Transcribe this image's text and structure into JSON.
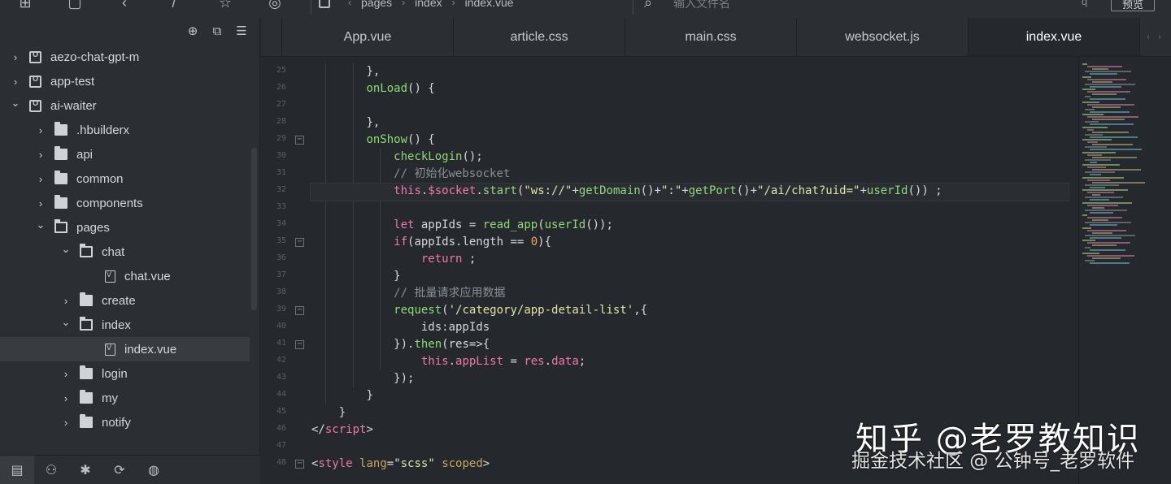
{
  "toolbar": {
    "breadcrumb": [
      "pages",
      "index",
      "index.vue"
    ],
    "search_placeholder": "输入文件名",
    "small_label": "q",
    "preview_label": "预览",
    "icons": [
      "new-file-icon",
      "window-icon",
      "back-icon",
      "forward-icon",
      "star-icon",
      "run-icon",
      "file-search-icon"
    ]
  },
  "sidebar": {
    "actions": [
      "target-icon",
      "collapse-icon",
      "menu-icon"
    ],
    "tree": [
      {
        "label": "aezo-chat-gpt-m",
        "type": "project",
        "level": 0,
        "expanded": false
      },
      {
        "label": "app-test",
        "type": "project",
        "level": 0,
        "expanded": false
      },
      {
        "label": "ai-waiter",
        "type": "project",
        "level": 0,
        "expanded": true
      },
      {
        "label": ".hbuilderx",
        "type": "folder",
        "level": 1,
        "expanded": false
      },
      {
        "label": "api",
        "type": "folder",
        "level": 1,
        "expanded": false
      },
      {
        "label": "common",
        "type": "folder",
        "level": 1,
        "expanded": false
      },
      {
        "label": "components",
        "type": "folder",
        "level": 1,
        "expanded": false
      },
      {
        "label": "pages",
        "type": "folder",
        "level": 1,
        "expanded": true
      },
      {
        "label": "chat",
        "type": "folder",
        "level": 2,
        "expanded": true
      },
      {
        "label": "chat.vue",
        "type": "file",
        "level": 3
      },
      {
        "label": "create",
        "type": "folder",
        "level": 2,
        "expanded": false
      },
      {
        "label": "index",
        "type": "folder",
        "level": 2,
        "expanded": true
      },
      {
        "label": "index.vue",
        "type": "file",
        "level": 3,
        "selected": true
      },
      {
        "label": "login",
        "type": "folder",
        "level": 2,
        "expanded": false
      },
      {
        "label": "my",
        "type": "folder",
        "level": 2,
        "expanded": false
      },
      {
        "label": "notify",
        "type": "folder",
        "level": 2,
        "expanded": false
      }
    ],
    "bottom_icons": [
      "project-manager-icon",
      "plugin-icon",
      "debug-icon",
      "git-icon",
      "browser-icon"
    ]
  },
  "tabs": [
    {
      "label": "App.vue",
      "active": false
    },
    {
      "label": "article.css",
      "active": false
    },
    {
      "label": "main.css",
      "active": false
    },
    {
      "label": "websocket.js",
      "active": false
    },
    {
      "label": "index.vue",
      "active": true
    }
  ],
  "editor": {
    "lines": [
      {
        "n": "25",
        "fold": false,
        "indent": 2,
        "tokens": [
          [
            "p",
            "},"
          ]
        ]
      },
      {
        "n": "26",
        "fold": false,
        "indent": 2,
        "tokens": [
          [
            "f",
            "onLoad"
          ],
          [
            "p",
            "() {"
          ]
        ]
      },
      {
        "n": "27",
        "fold": false,
        "indent": 3,
        "tokens": []
      },
      {
        "n": "28",
        "fold": false,
        "indent": 2,
        "tokens": [
          [
            "p",
            "},"
          ]
        ]
      },
      {
        "n": "29",
        "fold": true,
        "indent": 2,
        "tokens": [
          [
            "f",
            "onShow"
          ],
          [
            "p",
            "() {"
          ]
        ]
      },
      {
        "n": "30",
        "fold": false,
        "indent": 3,
        "tokens": [
          [
            "f",
            "checkLogin"
          ],
          [
            "p",
            "();"
          ]
        ]
      },
      {
        "n": "31",
        "fold": false,
        "indent": 3,
        "tokens": [
          [
            "c",
            "// 初始化websocket"
          ]
        ]
      },
      {
        "n": "32",
        "fold": false,
        "indent": 3,
        "current": true,
        "tokens": [
          [
            "k",
            "this"
          ],
          [
            "p",
            "."
          ],
          [
            "k",
            "$socket"
          ],
          [
            "p",
            "."
          ],
          [
            "f",
            "start"
          ],
          [
            "p",
            "("
          ],
          [
            "s",
            "\"ws://\""
          ],
          [
            "p",
            "+"
          ],
          [
            "f",
            "getDomain"
          ],
          [
            "p",
            "()+"
          ],
          [
            "s",
            "\":\""
          ],
          [
            "p",
            "+"
          ],
          [
            "f",
            "getPort"
          ],
          [
            "p",
            "()+"
          ],
          [
            "s",
            "\"/ai/chat?uid=\""
          ],
          [
            "p",
            "+"
          ],
          [
            "f",
            "userId"
          ],
          [
            "p",
            "()) ;"
          ]
        ]
      },
      {
        "n": "33",
        "fold": false,
        "indent": 3,
        "tokens": []
      },
      {
        "n": "34",
        "fold": false,
        "indent": 3,
        "tokens": [
          [
            "k",
            "let"
          ],
          [
            "p",
            " appIds = "
          ],
          [
            "f",
            "read_app"
          ],
          [
            "p",
            "("
          ],
          [
            "f",
            "userId"
          ],
          [
            "p",
            "());"
          ]
        ]
      },
      {
        "n": "35",
        "fold": true,
        "indent": 3,
        "tokens": [
          [
            "k",
            "if"
          ],
          [
            "p",
            "(appIds.length == "
          ],
          [
            "n",
            "0"
          ],
          [
            "p",
            "){"
          ]
        ]
      },
      {
        "n": "36",
        "fold": false,
        "indent": 4,
        "tokens": [
          [
            "k",
            "return"
          ],
          [
            "p",
            " ;"
          ]
        ]
      },
      {
        "n": "37",
        "fold": false,
        "indent": 3,
        "tokens": [
          [
            "p",
            "}"
          ]
        ]
      },
      {
        "n": "38",
        "fold": false,
        "indent": 3,
        "tokens": [
          [
            "c",
            "// 批量请求应用数据"
          ]
        ]
      },
      {
        "n": "39",
        "fold": true,
        "indent": 3,
        "tokens": [
          [
            "f",
            "request"
          ],
          [
            "p",
            "("
          ],
          [
            "s",
            "'/category/app-detail-list'"
          ],
          [
            "p",
            ",{"
          ]
        ]
      },
      {
        "n": "40",
        "fold": false,
        "indent": 4,
        "tokens": [
          [
            "p",
            "ids:appIds"
          ]
        ]
      },
      {
        "n": "41",
        "fold": true,
        "indent": 3,
        "tokens": [
          [
            "p",
            "})."
          ],
          [
            "f",
            "then"
          ],
          [
            "p",
            "(res=>{"
          ]
        ]
      },
      {
        "n": "42",
        "fold": false,
        "indent": 4,
        "tokens": [
          [
            "k",
            "this"
          ],
          [
            "p",
            "."
          ],
          [
            "k",
            "appList"
          ],
          [
            "p",
            " = "
          ],
          [
            "k",
            "res"
          ],
          [
            "p",
            "."
          ],
          [
            "k",
            "data"
          ],
          [
            "p",
            ";"
          ]
        ]
      },
      {
        "n": "43",
        "fold": false,
        "indent": 3,
        "tokens": [
          [
            "p",
            "});"
          ]
        ]
      },
      {
        "n": "44",
        "fold": false,
        "indent": 2,
        "tokens": [
          [
            "p",
            "}"
          ]
        ]
      },
      {
        "n": "45",
        "fold": false,
        "indent": 1,
        "tokens": [
          [
            "p",
            "}"
          ]
        ]
      },
      {
        "n": "46",
        "fold": false,
        "indent": 0,
        "tokens": [
          [
            "p",
            "</"
          ],
          [
            "t",
            "script"
          ],
          [
            "p",
            ">"
          ]
        ]
      },
      {
        "n": "47",
        "fold": false,
        "indent": 0,
        "tokens": []
      },
      {
        "n": "48",
        "fold": true,
        "indent": 0,
        "tokens": [
          [
            "p",
            "<"
          ],
          [
            "t",
            "style"
          ],
          [
            "p",
            " "
          ],
          [
            "a",
            "lang"
          ],
          [
            "p",
            "="
          ],
          [
            "s",
            "\"scss\""
          ],
          [
            "p",
            " "
          ],
          [
            "a",
            "scoped"
          ],
          [
            "p",
            ">"
          ]
        ]
      }
    ]
  },
  "watermark": {
    "line1": "知乎 @老罗教知识",
    "line2": "掘金技术社区 @ 公钟号_老罗软件"
  },
  "colors": {
    "function": "#8ddb75",
    "keyword": "#f078a8",
    "string": "#e3e4a4",
    "number": "#f3a460",
    "comment": "#8b8f94"
  }
}
